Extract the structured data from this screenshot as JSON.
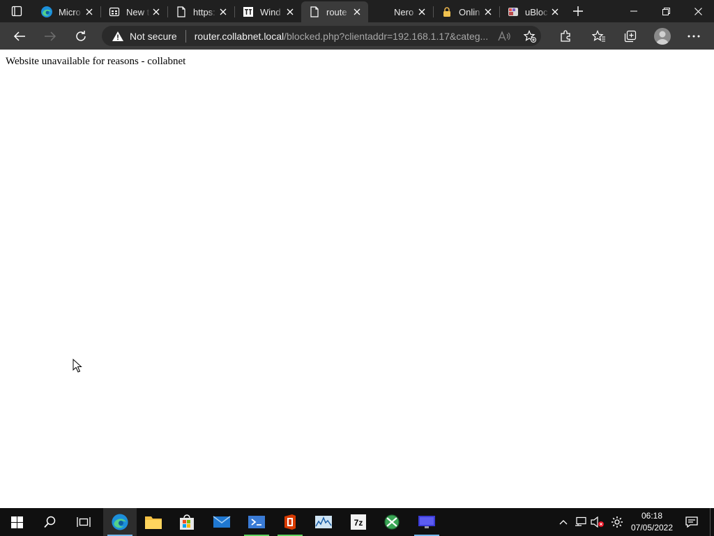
{
  "browser": {
    "tabs": [
      {
        "title": "Micro",
        "favicon": "edge-icon",
        "active": false
      },
      {
        "title": "New t",
        "favicon": "newtab-icon",
        "active": false
      },
      {
        "title": "https:",
        "favicon": "page-icon",
        "active": false
      },
      {
        "title": "Wind",
        "favicon": "it-icon",
        "active": false
      },
      {
        "title": "route",
        "favicon": "page-icon",
        "active": true
      },
      {
        "title": "Nero",
        "favicon": "nero-icon",
        "active": false
      },
      {
        "title": "Onlin",
        "favicon": "lock-icon",
        "active": false
      },
      {
        "title": "uBloc",
        "favicon": "ublock-icon",
        "active": false
      }
    ],
    "address_bar": {
      "security_label": "Not secure",
      "url_host": "router.collabnet.local",
      "url_rest": "/blocked.php?clientaddr=192.168.1.17&categ..."
    }
  },
  "page": {
    "message": "Website unavailable for reasons - collabnet"
  },
  "taskbar": {
    "apps": [
      "start",
      "search",
      "task-view",
      "edge",
      "file-explorer",
      "store",
      "mail",
      "visual-studio",
      "office",
      "resource-monitor",
      "7zip",
      "app-green",
      "remote-desktop"
    ],
    "clock": {
      "time": "06:18",
      "date": "07/05/2022"
    }
  },
  "colors": {
    "page_background": "#ffffff",
    "chrome_dark": "#202020",
    "toolbar": "#3b3b3b",
    "taskbar": "#101010",
    "taskbar_accent": "#76b9ed"
  }
}
